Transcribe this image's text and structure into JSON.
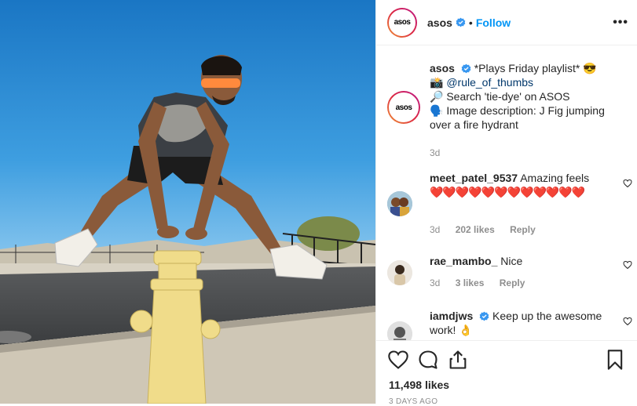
{
  "header": {
    "username": "asos",
    "follow_label": "Follow",
    "separator": "•",
    "more_label": "•••",
    "avatar_logo": "asos"
  },
  "caption": {
    "username": "asos",
    "line1": "*Plays Friday playlist* 😎",
    "line2_emoji": "📸",
    "mention": "@rule_of_thumbs",
    "line3": "🔎 Search 'tie-dye' on ASOS",
    "line4": "🗣️ Image description: J Fig jumping over a fire hydrant",
    "time": "3d",
    "avatar_logo": "asos"
  },
  "comments": [
    {
      "username": "meet_patel_9537",
      "text": "Amazing feels",
      "hearts": "❤️❤️❤️❤️❤️❤️❤️❤️❤️❤️❤️❤️",
      "time": "3d",
      "likes": "202 likes",
      "reply": "Reply"
    },
    {
      "username": "rae_mambo_",
      "text": "Nice",
      "time": "3d",
      "likes": "3 likes",
      "reply": "Reply"
    },
    {
      "username": "iamdjws",
      "text": "Keep up the awesome work! 👌"
    }
  ],
  "footer": {
    "likes": "11,498 likes",
    "timestamp": "3 DAYS AGO"
  },
  "icons": [
    "heart-icon",
    "comment-icon",
    "share-icon",
    "bookmark-icon",
    "verified-icon",
    "more-icon"
  ],
  "colors": {
    "accent": "#0095f6",
    "verified": "#3897f0",
    "heart": "#ed4956"
  }
}
